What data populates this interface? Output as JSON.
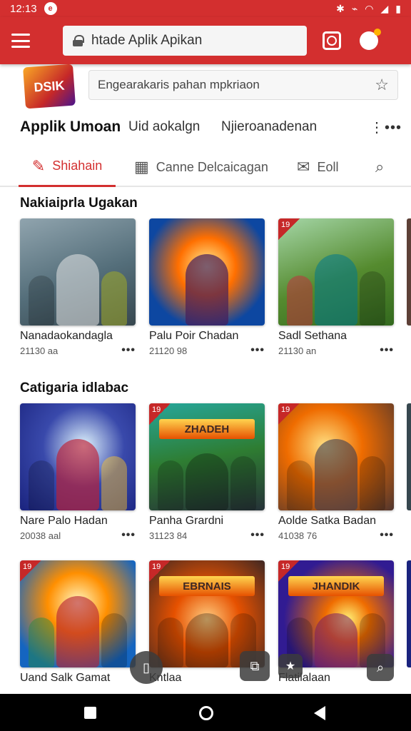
{
  "status_bar": {
    "time": "12:13",
    "notif_label": "e"
  },
  "browser": {
    "url": "htade Aplik Apikan"
  },
  "site": {
    "logo_text": "DSIK",
    "search_placeholder": "Engearakaris pahan mpkriaon"
  },
  "nav": {
    "title": "Applik Umoan",
    "links": [
      "Uid aokalgn",
      "Njieroanadenan"
    ],
    "more": "⋮•••"
  },
  "tabs": [
    {
      "label": "Shiahain",
      "icon": "pencil-icon"
    },
    {
      "label": "Canne Delcaicagan",
      "icon": "calendar-icon"
    },
    {
      "label": "Eoll",
      "icon": "mail-icon"
    }
  ],
  "sections": [
    {
      "title": "Nakiaiprla Ugakan",
      "cards": [
        {
          "title": "Nanadaokandagla",
          "meta": "21130 aa",
          "badge": ""
        },
        {
          "title": "Palu Poir Chadan",
          "meta": "21120 98",
          "badge": ""
        },
        {
          "title": "Sadl Sethana",
          "meta": "21130 an",
          "badge": "19"
        }
      ]
    },
    {
      "title": "Catigaria idlabac",
      "cards": [
        {
          "title": "Nare Palo Hadan",
          "meta": "20038 aal",
          "badge": ""
        },
        {
          "title": "Panha Grardni",
          "meta": "31123 84",
          "badge": "19",
          "banner": "ZHADEH"
        },
        {
          "title": "Aolde Satka Badan",
          "meta": "41038 76",
          "badge": "19"
        }
      ]
    },
    {
      "title": "",
      "cards": [
        {
          "title": "Uand Salk Gamat",
          "meta": "",
          "badge": "19"
        },
        {
          "title": "Kntlaa",
          "meta": "",
          "badge": "19",
          "banner": "EBRNAIS"
        },
        {
          "title": "Flatilalaan",
          "meta": "",
          "badge": "19",
          "banner": "JHANDIK"
        }
      ]
    }
  ],
  "floating": [
    "clipboard-icon",
    "image-icon",
    "star-icon",
    "search-icon"
  ],
  "colors": {
    "accent": "#d32f2f"
  }
}
